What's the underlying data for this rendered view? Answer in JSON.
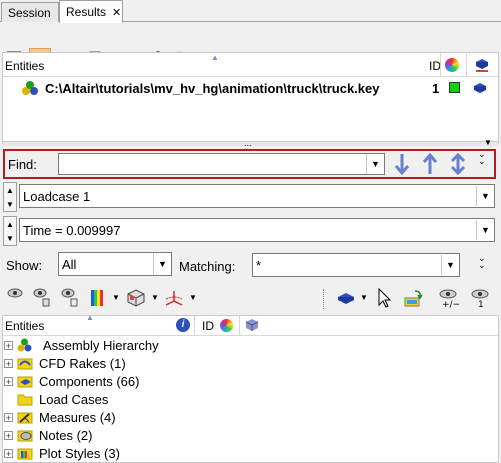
{
  "tabs": [
    {
      "label": "Session"
    },
    {
      "label": "Results",
      "close": "✕"
    }
  ],
  "toolbar": {
    "icons": [
      "import-results-icon",
      "model-view-icon",
      "layers-icon",
      "add-entity-icon",
      "legend-icon",
      "connect-icon",
      "cylinder-icon"
    ]
  },
  "top_panel": {
    "header_entities": "Entities",
    "header_id": "ID",
    "row_path": "C:\\Altair\\tutorials\\mv_hv_hg\\animation\\truck\\truck.key",
    "row_id": "1",
    "splitter_dots": "..."
  },
  "find": {
    "label": "Find:",
    "value": ""
  },
  "loadcase": {
    "value": "Loadcase 1"
  },
  "time": {
    "value": "Time = 0.009997"
  },
  "show": {
    "label": "Show:",
    "value": "All"
  },
  "matching": {
    "label": "Matching:",
    "value": "*"
  },
  "tree_header": {
    "entities": "Entities",
    "id": "ID"
  },
  "tree_items": [
    {
      "label": "Assembly Hierarchy",
      "icon": "assembly-icon"
    },
    {
      "label": "CFD Rakes (1)",
      "icon": "cfd-rakes-icon"
    },
    {
      "label": "Components (66)",
      "icon": "components-icon"
    },
    {
      "label": "Load Cases",
      "icon": "folder-icon"
    },
    {
      "label": "Measures (4)",
      "icon": "measures-icon"
    },
    {
      "label": "Notes (2)",
      "icon": "notes-icon"
    },
    {
      "label": "Plot Styles (3)",
      "icon": "plot-styles-icon"
    }
  ],
  "colors": {
    "accent_blue": "#2f4fbf",
    "find_border": "#b01e23",
    "green_indicator": "#11d011",
    "arrow_blue": "#6a7fd0"
  }
}
